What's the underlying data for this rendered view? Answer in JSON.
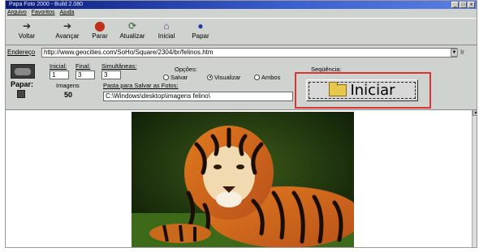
{
  "window": {
    "title": "Papa Foto 2000 - Build 2.080",
    "buttons": [
      "_",
      "□",
      "x"
    ]
  },
  "menu": [
    "Arquivo",
    "Favoritos",
    "Ajuda"
  ],
  "toolbar": {
    "buttons": [
      {
        "label": "Voltar",
        "icon": "back-arrow-icon"
      },
      {
        "label": "Avançar",
        "icon": "forward-arrow-icon"
      },
      {
        "label": "Parar",
        "icon": "stop-icon"
      },
      {
        "label": "Atualizar",
        "icon": "refresh-icon"
      },
      {
        "label": "Inicial",
        "icon": "home-icon"
      },
      {
        "label": "Papar",
        "icon": "papar-icon"
      }
    ]
  },
  "address": {
    "label": "Endereço",
    "value": "http://www.geocities.com/SoHo/Square/2304/br/felinos.htm",
    "go": "Ir"
  },
  "controls": {
    "inicial_label": "Inicial:",
    "inicial_value": "1",
    "final_label": "Final:",
    "final_value": "3",
    "simultaneas_label": "Simultâneas:",
    "simultaneas_value": "3",
    "opcoes_label": "Opções:",
    "salvar": "Salvar",
    "visualizar": "Visualizar",
    "ambos": "Ambos",
    "sequencia_label": "Seqüência:",
    "papar_label": "Papar:",
    "imagens_label": "Imagens",
    "imagens_value": "50",
    "pasta_label": "Pasta para Salvar as Fotos:",
    "pasta_value": "C:\\Windows\\desktop\\imagens felino\\",
    "iniciar": "Iniciar"
  },
  "colors": {
    "highlight_border": "#dd3333",
    "titlebar": "#0a1a7a"
  }
}
